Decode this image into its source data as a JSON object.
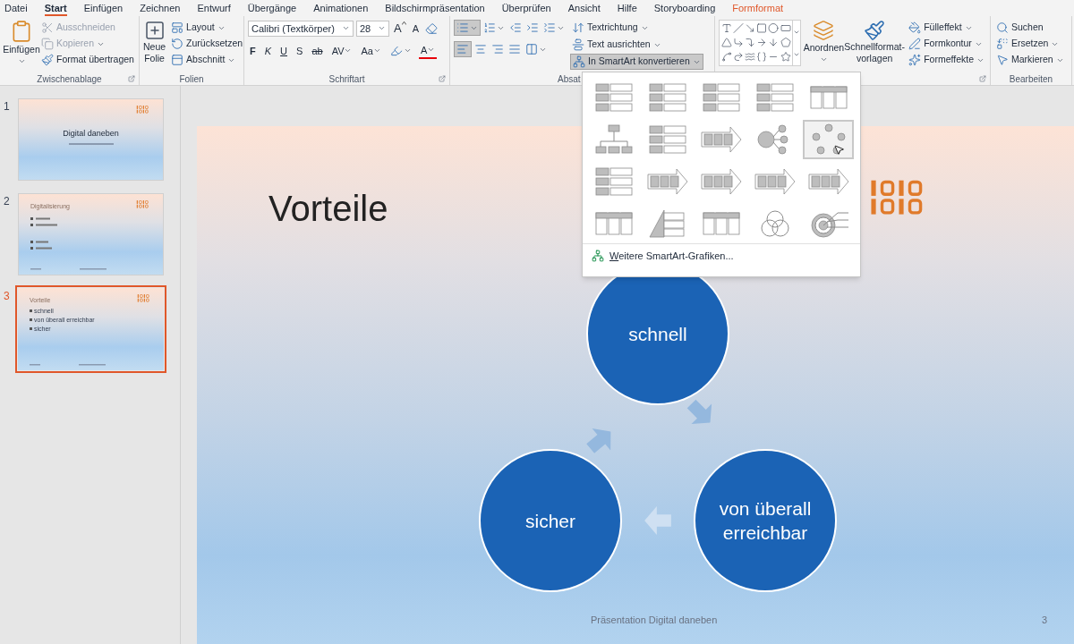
{
  "menu_tabs": [
    {
      "label": "Datei",
      "selected": false,
      "kind": "standard"
    },
    {
      "label": "Start",
      "selected": true,
      "kind": "standard"
    },
    {
      "label": "Einfügen",
      "selected": false,
      "kind": "standard"
    },
    {
      "label": "Zeichnen",
      "selected": false,
      "kind": "standard"
    },
    {
      "label": "Entwurf",
      "selected": false,
      "kind": "standard"
    },
    {
      "label": "Übergänge",
      "selected": false,
      "kind": "standard"
    },
    {
      "label": "Animationen",
      "selected": false,
      "kind": "standard"
    },
    {
      "label": "Bildschirmpräsentation",
      "selected": false,
      "kind": "standard"
    },
    {
      "label": "Überprüfen",
      "selected": false,
      "kind": "standard"
    },
    {
      "label": "Ansicht",
      "selected": false,
      "kind": "standard"
    },
    {
      "label": "Hilfe",
      "selected": false,
      "kind": "standard"
    },
    {
      "label": "Storyboarding",
      "selected": false,
      "kind": "standard"
    },
    {
      "label": "Formformat",
      "selected": false,
      "kind": "contextual"
    }
  ],
  "ribbon": {
    "clipboard": {
      "label": "Zwischenablage",
      "paste": "Einfügen",
      "cut": {
        "label": "Ausschneiden",
        "disabled": true
      },
      "copy": {
        "label": "Kopieren",
        "disabled": true
      },
      "format_painter": {
        "label": "Format übertragen",
        "disabled": false
      }
    },
    "slides": {
      "label": "Folien",
      "new_slide": "Neue Folie",
      "layout": "Layout",
      "reset": "Zurücksetzen",
      "section": "Abschnitt"
    },
    "font": {
      "label": "Schriftart",
      "font_name": "Calibri (Textkörper)",
      "font_size": "28",
      "grow": "A",
      "shrink": "A",
      "bold": "F",
      "italic": "K",
      "underline": "U",
      "shadow": "S",
      "strike": "ab",
      "spacing": "AV",
      "case": "Aa",
      "font_color": "A"
    },
    "paragraph": {
      "label": "Absat",
      "bullets": {
        "selected": true
      },
      "numbering": {
        "selected": false
      },
      "alignment": [
        {
          "selected": true
        },
        {
          "selected": false
        },
        {
          "selected": false
        },
        {
          "selected": false
        }
      ],
      "text_direction": "Textrichtung",
      "align_text": "Text ausrichten",
      "smartart": {
        "label": "In SmartArt konvertieren",
        "selected": true
      }
    },
    "drawing": {
      "arrange": "Anordnen",
      "quick_styles": "Schnellformat-vorlagen",
      "fill": "Fülleffekt",
      "outline": "Formkontur",
      "effects": "Formeffekte"
    },
    "editing": {
      "label": "Bearbeiten",
      "find": "Suchen",
      "replace": "Ersetzen",
      "select": "Markieren"
    }
  },
  "thumbnails": [
    {
      "number": "1",
      "selected": false,
      "kind": "title",
      "title": "Digital daneben"
    },
    {
      "number": "2",
      "selected": false,
      "kind": "content",
      "title": "Digitalisierung"
    },
    {
      "number": "3",
      "selected": true,
      "kind": "content",
      "title": "Vorteile",
      "bullets": [
        "schnell",
        "von überall erreichbar",
        "sicher"
      ]
    }
  ],
  "slide": {
    "title": "Vorteile",
    "nodes": [
      "schnell",
      "sicher",
      "von überall erreichbar"
    ],
    "footer": "Präsentation Digital daneben",
    "page_number": "3"
  },
  "smartart_menu": {
    "layouts": [
      {
        "kind": "list",
        "selected": false
      },
      {
        "kind": "list",
        "selected": false
      },
      {
        "kind": "list",
        "selected": false
      },
      {
        "kind": "list",
        "selected": false
      },
      {
        "kind": "matrix",
        "selected": false
      },
      {
        "kind": "hierarchy",
        "selected": false
      },
      {
        "kind": "list",
        "selected": false
      },
      {
        "kind": "process",
        "selected": false
      },
      {
        "kind": "radial",
        "selected": false
      },
      {
        "kind": "cycle",
        "selected": true
      },
      {
        "kind": "list",
        "selected": false
      },
      {
        "kind": "process",
        "selected": false
      },
      {
        "kind": "process",
        "selected": false
      },
      {
        "kind": "process",
        "selected": false
      },
      {
        "kind": "process",
        "selected": false
      },
      {
        "kind": "matrix",
        "selected": false
      },
      {
        "kind": "pyramid",
        "selected": false
      },
      {
        "kind": "matrix",
        "selected": false
      },
      {
        "kind": "venn",
        "selected": false
      },
      {
        "kind": "target",
        "selected": false
      }
    ],
    "more": "Weitere SmartArt-Grafiken..."
  }
}
